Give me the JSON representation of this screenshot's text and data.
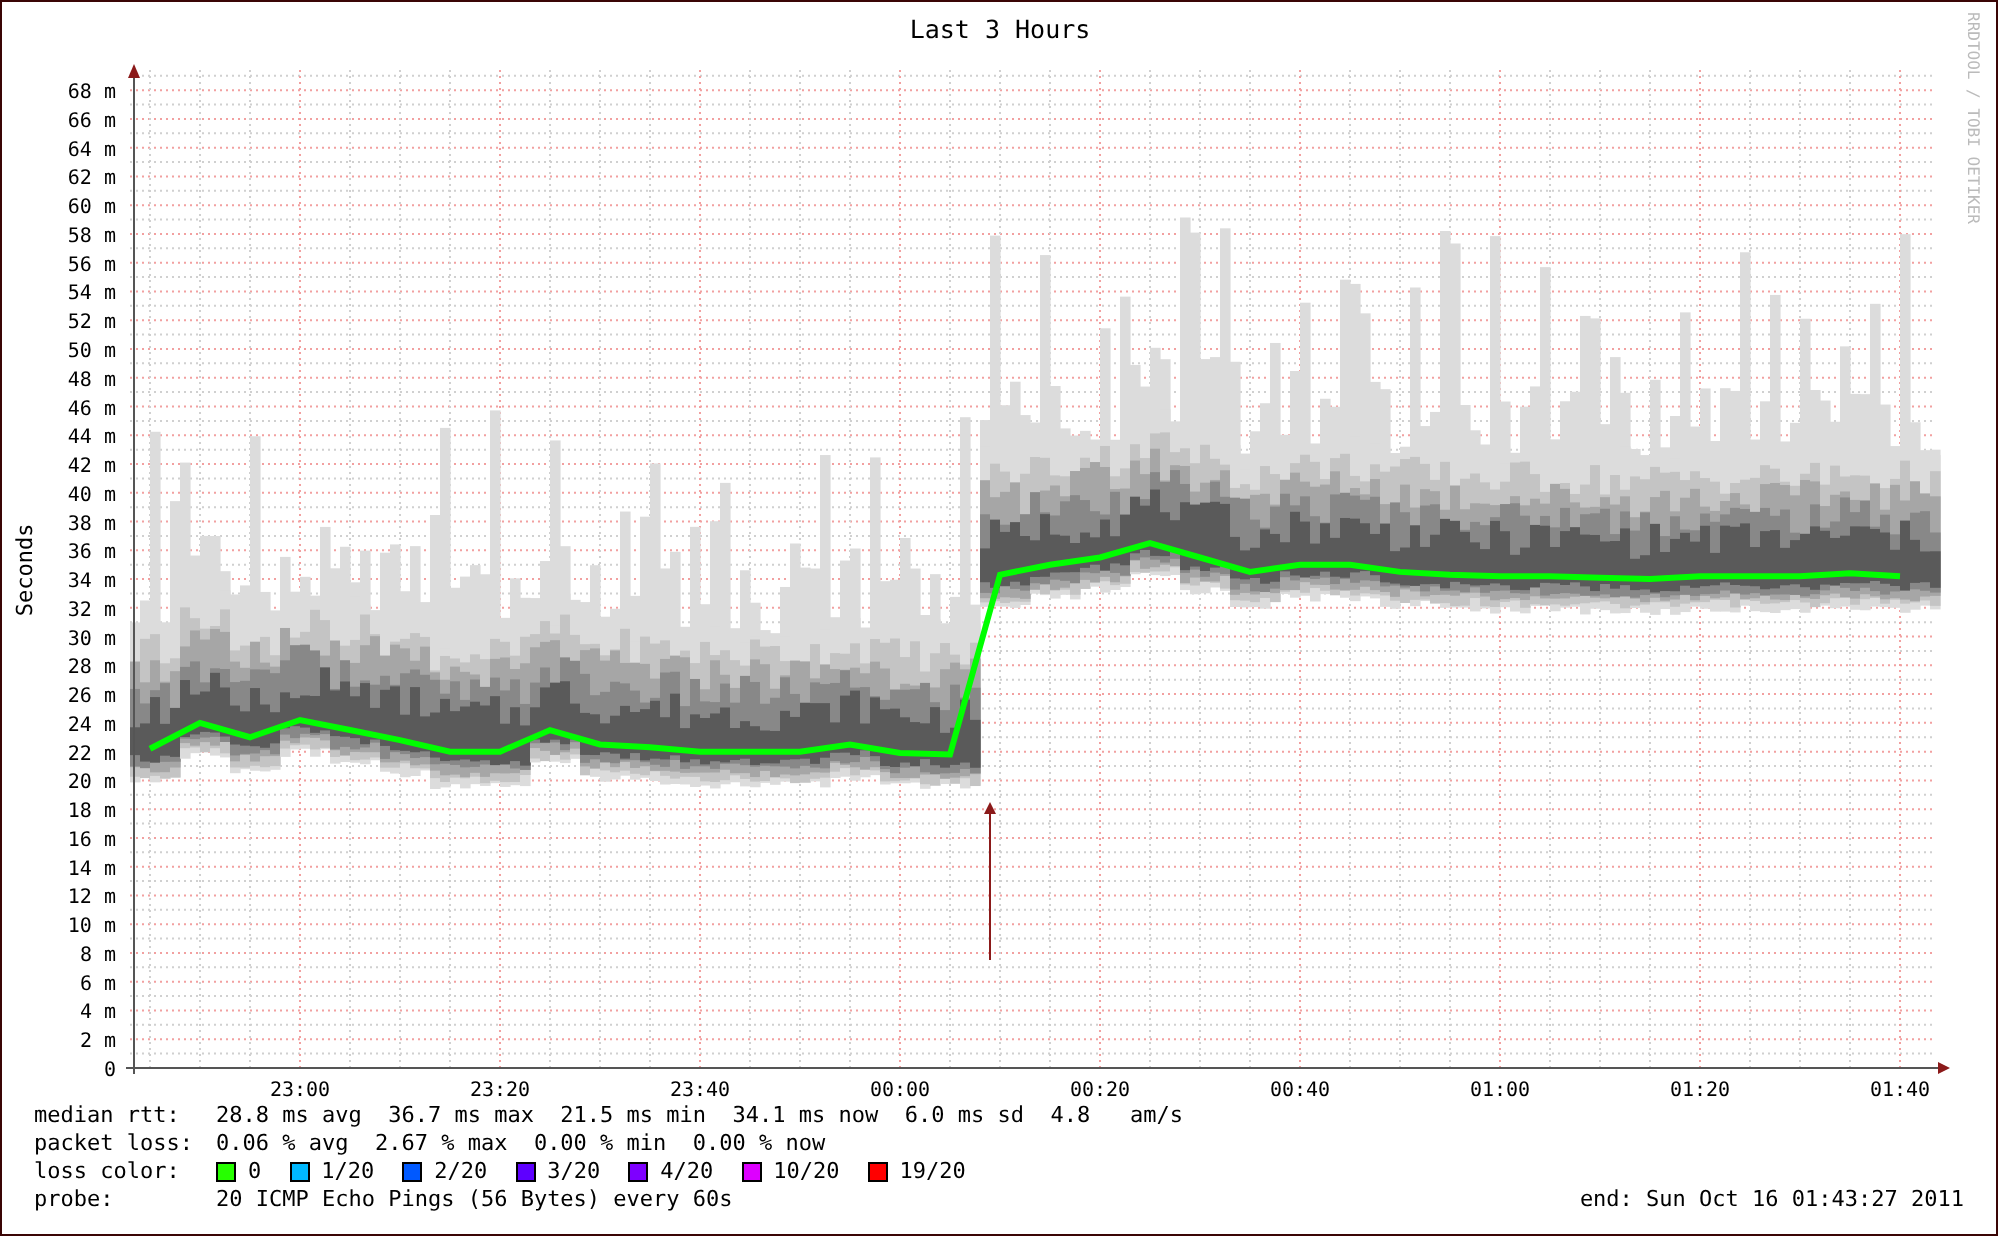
{
  "graph": {
    "side_text": "RRDTOOL / TOBI OETIKER",
    "chart_data": {
      "type": "line",
      "title": "Last 3 Hours",
      "ylabel": "Seconds",
      "ylim": [
        0,
        69.4
      ],
      "grid": true,
      "categories": [
        null,
        null,
        null,
        "23:00",
        null,
        null,
        null,
        "23:20",
        null,
        null,
        null,
        "23:40",
        null,
        null,
        null,
        "00:00",
        null,
        null,
        null,
        "00:20",
        null,
        null,
        null,
        "00:40",
        null,
        null,
        null,
        "01:00",
        null,
        null,
        null,
        "01:20",
        null,
        null,
        null,
        "01:40"
      ],
      "series": [
        {
          "color": "#00ff00",
          "values": [
            22.2,
            24.0,
            23.0,
            24.2,
            23.5,
            22.8,
            22.0,
            22.0,
            23.5,
            22.5,
            22.3,
            22.0,
            22.0,
            22.0,
            22.5,
            21.9,
            21.8,
            34.3,
            35.0,
            35.5,
            36.5,
            35.5,
            34.5,
            35.0,
            35.0,
            34.5,
            34.3,
            34.2,
            34.2,
            34.1,
            34.0,
            34.2,
            34.2,
            34.2,
            34.4,
            34.2
          ]
        }
      ],
      "yticks": [
        {
          "value": 0,
          "label": "0"
        },
        {
          "value": 2,
          "label": "2 m"
        },
        {
          "value": 4,
          "label": "4 m"
        },
        {
          "value": 6,
          "label": "6 m"
        },
        {
          "value": 8,
          "label": "8 m"
        },
        {
          "value": 10,
          "label": "10 m"
        },
        {
          "value": 12,
          "label": "12 m"
        },
        {
          "value": 14,
          "label": "14 m"
        },
        {
          "value": 16,
          "label": "16 m"
        },
        {
          "value": 18,
          "label": "18 m"
        },
        {
          "value": 20,
          "label": "20 m"
        },
        {
          "value": 22,
          "label": "22 m"
        },
        {
          "value": 24,
          "label": "24 m"
        },
        {
          "value": 26,
          "label": "26 m"
        },
        {
          "value": 28,
          "label": "28 m"
        },
        {
          "value": 30,
          "label": "30 m"
        },
        {
          "value": 32,
          "label": "32 m"
        },
        {
          "value": 34,
          "label": "34 m"
        },
        {
          "value": 36,
          "label": "36 m"
        },
        {
          "value": 38,
          "label": "38 m"
        },
        {
          "value": 40,
          "label": "40 m"
        },
        {
          "value": 42,
          "label": "42 m"
        },
        {
          "value": 44,
          "label": "44 m"
        },
        {
          "value": 46,
          "label": "46 m"
        },
        {
          "value": 48,
          "label": "48 m"
        },
        {
          "value": 50,
          "label": "50 m"
        },
        {
          "value": 52,
          "label": "52 m"
        },
        {
          "value": 54,
          "label": "54 m"
        },
        {
          "value": 56,
          "label": "56 m"
        },
        {
          "value": 58,
          "label": "58 m"
        },
        {
          "value": 60,
          "label": "60 m"
        },
        {
          "value": 62,
          "label": "62 m"
        },
        {
          "value": 64,
          "label": "64 m"
        },
        {
          "value": 66,
          "label": "66 m"
        },
        {
          "value": 68,
          "label": "68 m"
        }
      ]
    }
  },
  "legend": {
    "stats": [
      {
        "label": "median rtt:",
        "value": "28.8 ms avg  36.7 ms max  21.5 ms min  34.1 ms now  6.0 ms sd  4.8   am/s"
      },
      {
        "label": "packet loss:",
        "value": "0.06 % avg  2.67 % max  0.00 % min  0.00 % now"
      }
    ],
    "loss_colors": {
      "label": "loss color:",
      "items": [
        {
          "label": "0",
          "color": "#26ff00"
        },
        {
          "label": "1/20",
          "color": "#00b8ff"
        },
        {
          "label": "2/20",
          "color": "#0059ff"
        },
        {
          "label": "3/20",
          "color": "#5e00ff"
        },
        {
          "label": "4/20",
          "color": "#7e00ff"
        },
        {
          "label": "10/20",
          "color": "#dd00ff"
        },
        {
          "label": "19/20",
          "color": "#ff0000"
        }
      ]
    },
    "probe": {
      "label": "probe:",
      "value": "20 ICMP Echo Pings (56 Bytes) every 60s"
    },
    "end": "end: Sun Oct 16 01:43:27 2011"
  }
}
